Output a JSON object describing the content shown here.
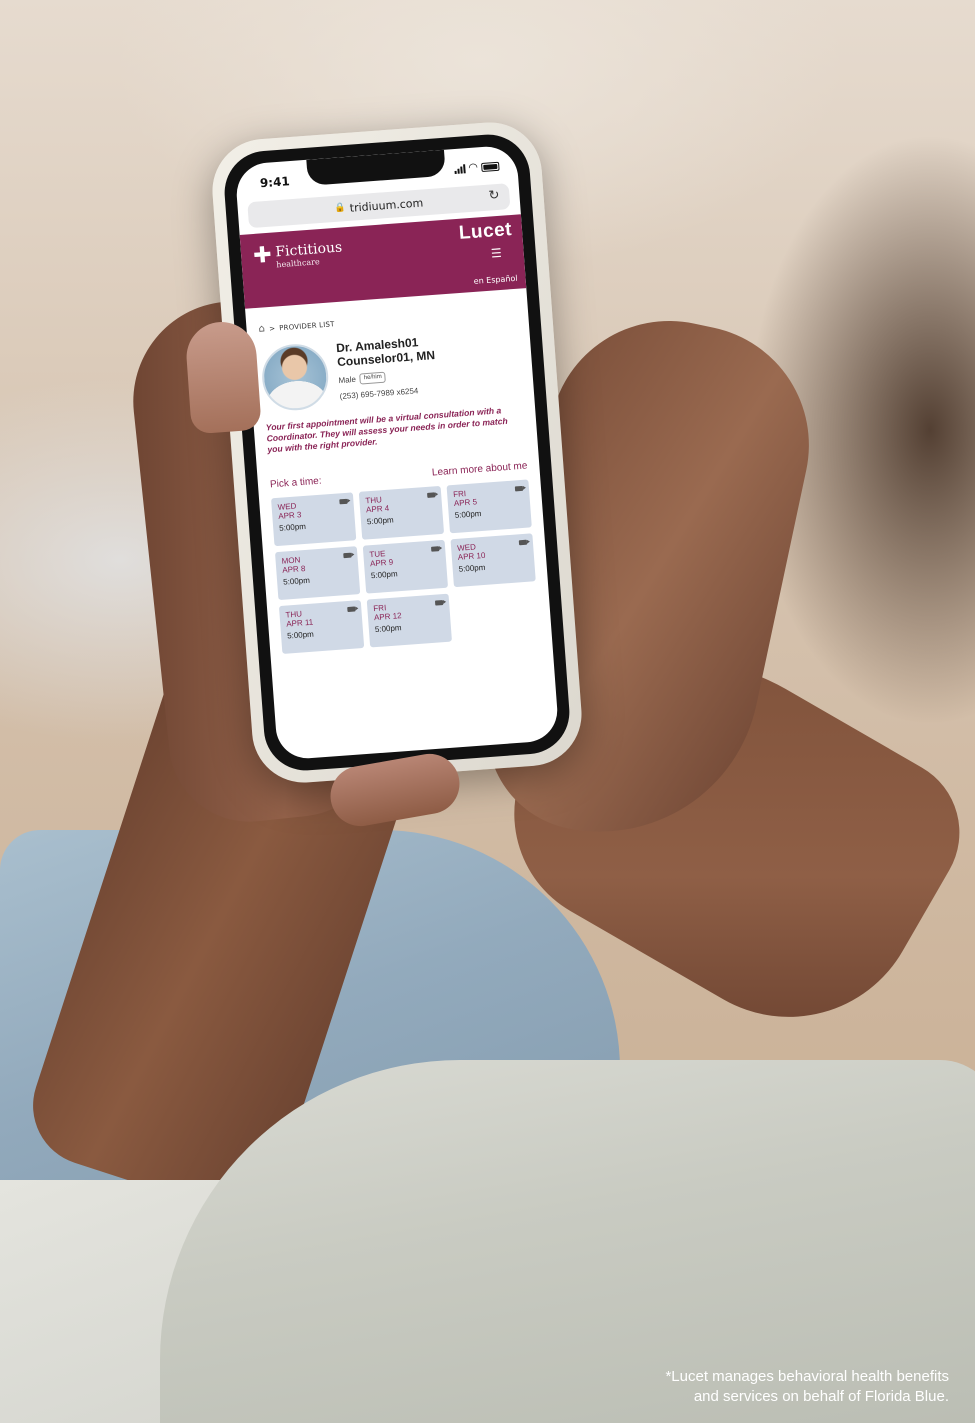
{
  "status_bar": {
    "time": "9:41"
  },
  "browser": {
    "url": "tridiuum.com"
  },
  "header": {
    "brand_name": "Fictitious",
    "brand_sub": "healthcare",
    "partner_logo": "Lucet",
    "language_link": "en Español",
    "background_color": "#8a2456"
  },
  "breadcrumb": {
    "label": "PROVIDER LIST"
  },
  "provider": {
    "name_line1": "Dr. Amalesh01",
    "name_line2": "Counselor01, MN",
    "gender": "Male",
    "pronouns": "he/him",
    "phone": "(253) 695-7989 x6254"
  },
  "notice": "Your first appointment will be a virtual consultation with a Coordinator. They will assess your needs in order to match you with the right provider.",
  "scheduling": {
    "pick_label": "Pick a time:",
    "learn_more": "Learn more about me",
    "slots": [
      {
        "day": "WED",
        "date": "APR 3",
        "time": "5:00pm"
      },
      {
        "day": "THU",
        "date": "APR 4",
        "time": "5:00pm"
      },
      {
        "day": "FRI",
        "date": "APR 5",
        "time": "5:00pm"
      },
      {
        "day": "MON",
        "date": "APR 8",
        "time": "5:00pm"
      },
      {
        "day": "TUE",
        "date": "APR 9",
        "time": "5:00pm"
      },
      {
        "day": "WED",
        "date": "APR 10",
        "time": "5:00pm"
      },
      {
        "day": "THU",
        "date": "APR 11",
        "time": "5:00pm"
      },
      {
        "day": "FRI",
        "date": "APR 12",
        "time": "5:00pm"
      }
    ]
  },
  "disclaimer": {
    "line1": "*Lucet manages behavioral health benefits",
    "line2": "and services on behalf of Florida Blue."
  },
  "icons": [
    "signal-icon",
    "wifi-icon",
    "battery-icon",
    "lock-icon",
    "reload-icon",
    "plus-icon",
    "filter-icon",
    "home-icon",
    "video-icon"
  ]
}
